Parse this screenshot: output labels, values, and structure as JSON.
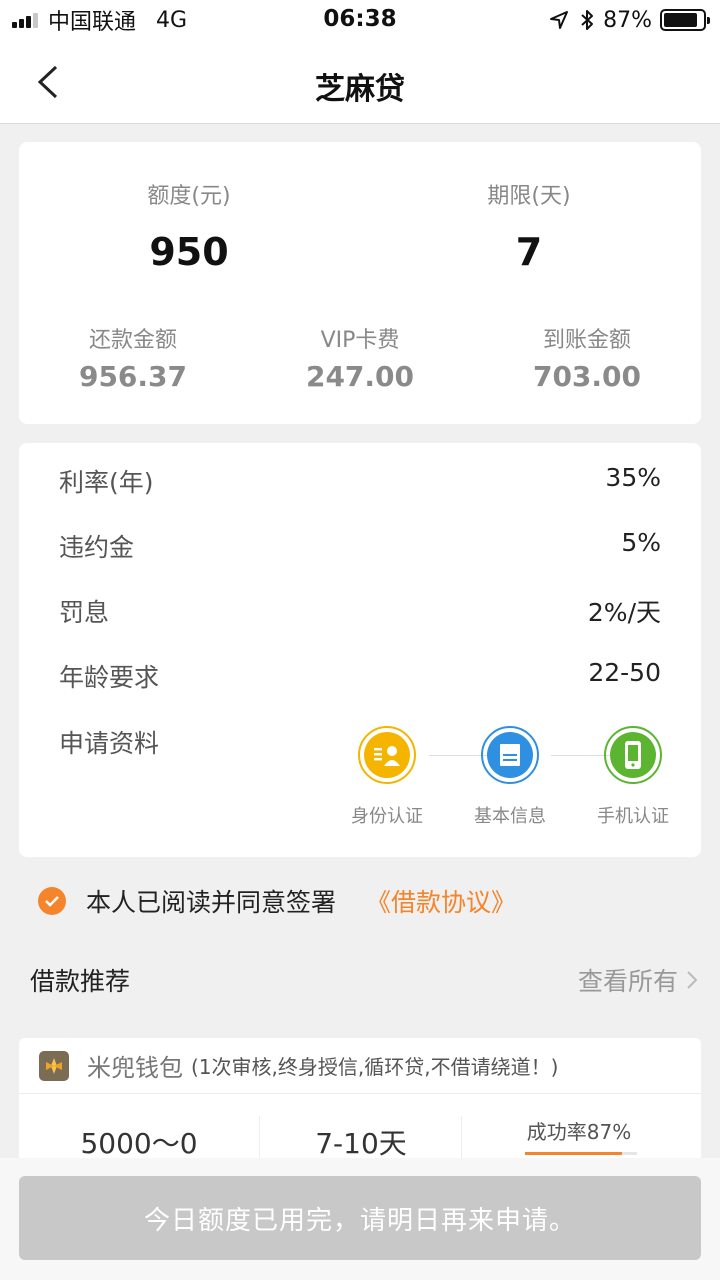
{
  "status_bar": {
    "carrier": "中国联通",
    "network": "4G",
    "time": "06:38",
    "battery": "87%",
    "battery_level": 0.87
  },
  "nav": {
    "title": "芝麻贷"
  },
  "summary": {
    "quota_label": "额度(元)",
    "quota_value": "950",
    "term_label": "期限(天)",
    "term_value": "7",
    "repay_label": "还款金额",
    "repay_value": "956.37",
    "vip_label": "VIP卡费",
    "vip_value": "247.00",
    "arrival_label": "到账金额",
    "arrival_value": "703.00"
  },
  "details": {
    "rows": [
      {
        "label": "利率(年)",
        "value": "35%"
      },
      {
        "label": "违约金",
        "value": "5%"
      },
      {
        "label": "罚息",
        "value": "2%/天"
      },
      {
        "label": "年龄要求",
        "value": "22-50"
      }
    ],
    "materials_label": "申请资料",
    "steps": [
      {
        "label": "身份认证",
        "icon": "id-card-icon",
        "color": "#f5b400"
      },
      {
        "label": "基本信息",
        "icon": "info-doc-icon",
        "color": "#2f8fe0"
      },
      {
        "label": "手机认证",
        "icon": "phone-icon",
        "color": "#5cb531"
      }
    ]
  },
  "agreement": {
    "text": "本人已阅读并同意签署",
    "link": "《借款协议》",
    "accent": "#f5842a"
  },
  "recommend": {
    "title": "借款推荐",
    "view_all": "查看所有",
    "item": {
      "name": "米兜钱包",
      "desc": "(1次审核,终身授信,循环贷,不借请绕道！)",
      "amount": "5000～0",
      "term": "7-10天",
      "success": "成功率87%",
      "success_rate": 0.87
    }
  },
  "bottom": {
    "button": "今日额度已用完，请明日再来申请。"
  }
}
